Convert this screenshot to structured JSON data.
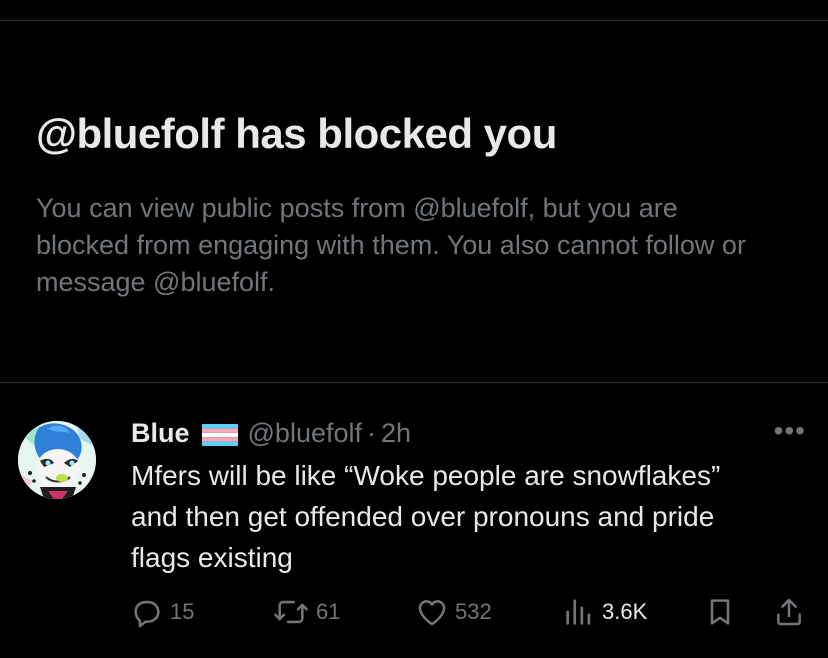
{
  "blocked": {
    "title": "@bluefolf has blocked you",
    "message": "You can view public posts from @bluefolf, but you are blocked from engaging with them. You also cannot follow or message @bluefolf."
  },
  "post": {
    "display_name": "Blue",
    "handle": "@bluefolf",
    "separator": "·",
    "time": "2h",
    "more": "•••",
    "text": "Mfers will be like “Woke people are snowflakes” and then get offended over pronouns and pride flags existing",
    "actions": {
      "replies": "15",
      "reposts": "61",
      "likes": "532",
      "views": "3.6K"
    }
  },
  "icons": [
    "trans-flag-icon",
    "reply-icon",
    "repost-icon",
    "like-icon",
    "views-icon",
    "bookmark-icon",
    "share-icon",
    "more-icon"
  ],
  "colors": {
    "background": "#000000",
    "text_primary": "#e7e9ea",
    "text_secondary": "#71767b",
    "divider": "#2f3336"
  }
}
